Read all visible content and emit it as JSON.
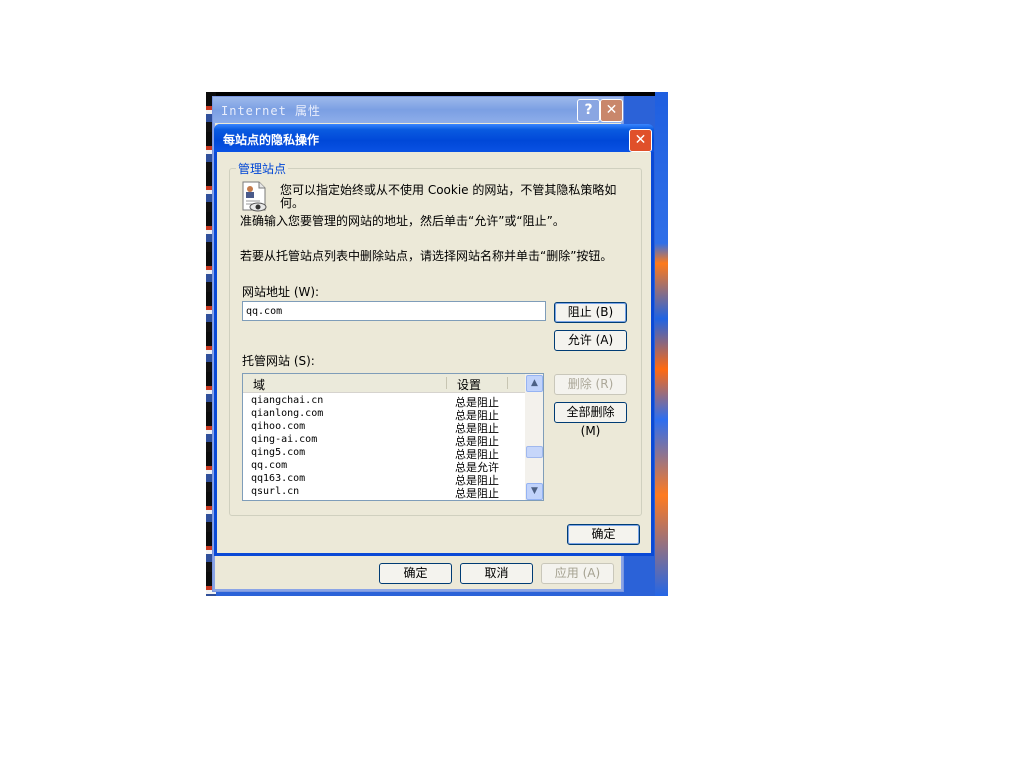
{
  "back_window": {
    "title": "Internet 属性",
    "help_glyph": "?",
    "close_glyph": "✕",
    "buttons": {
      "ok": "确定",
      "cancel": "取消",
      "apply": "应用 (A)"
    }
  },
  "dialog": {
    "title": "每站点的隐私操作",
    "close_glyph": "✕",
    "group_label": "管理站点",
    "description_line1": "您可以指定始终或从不使用 Cookie 的网站，不管其隐私策略如",
    "description_line2": "何。",
    "instruction1": "准确输入您要管理的网站的地址，然后单击“允许”或“阻止”。",
    "instruction2": "若要从托管站点列表中删除站点，请选择网站名称并单击“删除”按钮。",
    "address_label": "网站地址 (W):",
    "address_value": "qq.com",
    "block_button": "阻止 (B)",
    "allow_button": "允许 (A)",
    "managed_label": "托管网站 (S):",
    "remove_button": "删除 (R)",
    "remove_all_button": "全部删除 (M)",
    "ok_button": "确定",
    "list": {
      "headers": {
        "domain": "域",
        "setting": "设置"
      },
      "rows": [
        {
          "domain": "qiangchai.cn",
          "setting": "总是阻止"
        },
        {
          "domain": "qianlong.com",
          "setting": "总是阻止"
        },
        {
          "domain": "qihoo.com",
          "setting": "总是阻止"
        },
        {
          "domain": "qing-ai.com",
          "setting": "总是阻止"
        },
        {
          "domain": "qing5.com",
          "setting": "总是阻止"
        },
        {
          "domain": "qq.com",
          "setting": "总是允许"
        },
        {
          "domain": "qq163.com",
          "setting": "总是阻止"
        },
        {
          "domain": "qsurl.cn",
          "setting": "总是阻止"
        }
      ]
    }
  }
}
